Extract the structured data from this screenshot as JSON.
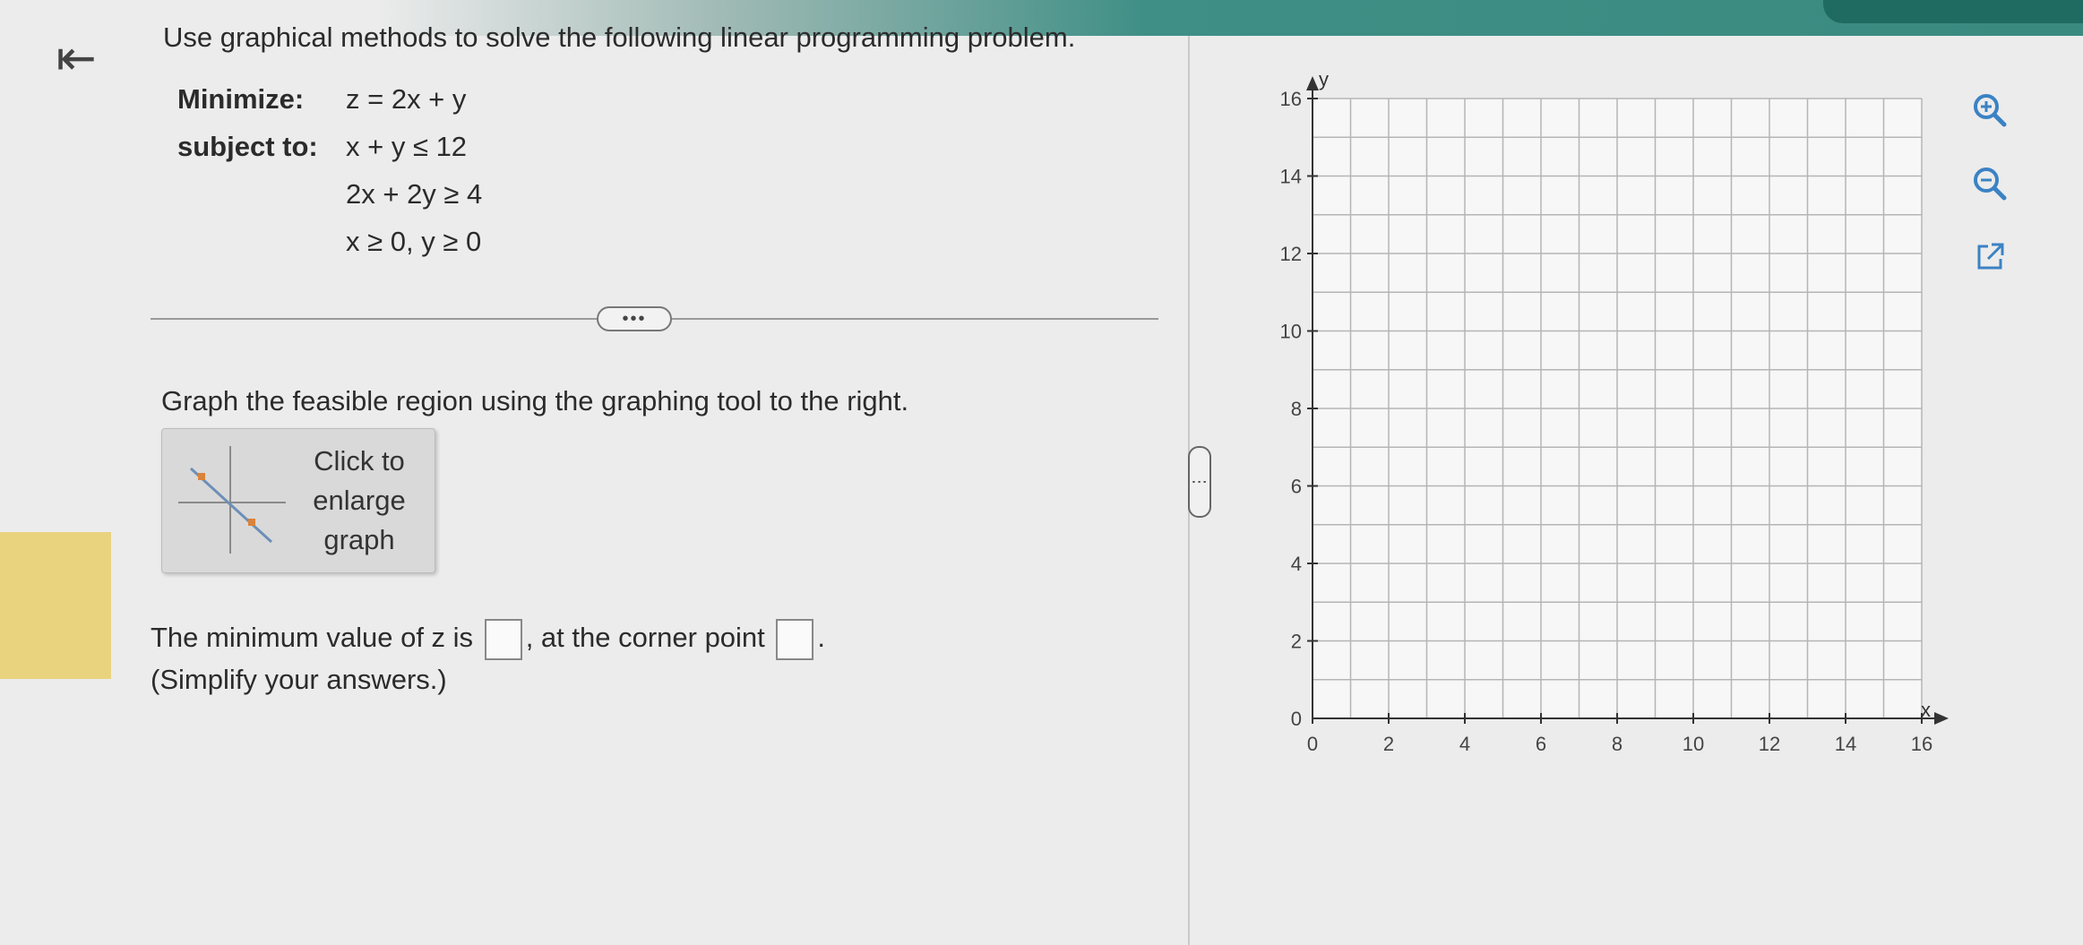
{
  "nav": {
    "back_glyph": "⇤"
  },
  "question": {
    "text": "Use graphical methods to solve the following linear programming problem."
  },
  "problem": {
    "minimize_label": "Minimize:",
    "objective": "z = 2x + y",
    "subject_label": "subject to:",
    "constraints": [
      "x + y ≤ 12",
      "2x + 2y ≥ 4",
      "x ≥ 0, y ≥ 0"
    ]
  },
  "more_button": {
    "label": "•••"
  },
  "instruction": {
    "text": "Graph the feasible region using the graphing tool to the right."
  },
  "enlarge_button": {
    "line1": "Click to",
    "line2": "enlarge",
    "line3": "graph"
  },
  "answer": {
    "prefix": "The minimum value of z is",
    "middle": ", at the corner point",
    "suffix": ".",
    "note": "(Simplify your answers.)"
  },
  "graph": {
    "x_axis_label": "x",
    "y_axis_label": "y",
    "x_range": [
      0,
      16
    ],
    "y_range": [
      0,
      16
    ],
    "x_tick_labels": [
      "0",
      "2",
      "4",
      "6",
      "8",
      "10",
      "12",
      "14",
      "16"
    ],
    "y_tick_labels": [
      "0",
      "2",
      "4",
      "6",
      "8",
      "10",
      "12",
      "14",
      "16"
    ],
    "grid": true
  },
  "tools": [
    "zoom-in-icon",
    "zoom-out-icon",
    "external-link-icon"
  ],
  "colors": {
    "accent": "#3a8a80",
    "accent_dark": "#1f6b62",
    "tool_blue": "#3b82c4",
    "highlight": "#e9d37e"
  }
}
